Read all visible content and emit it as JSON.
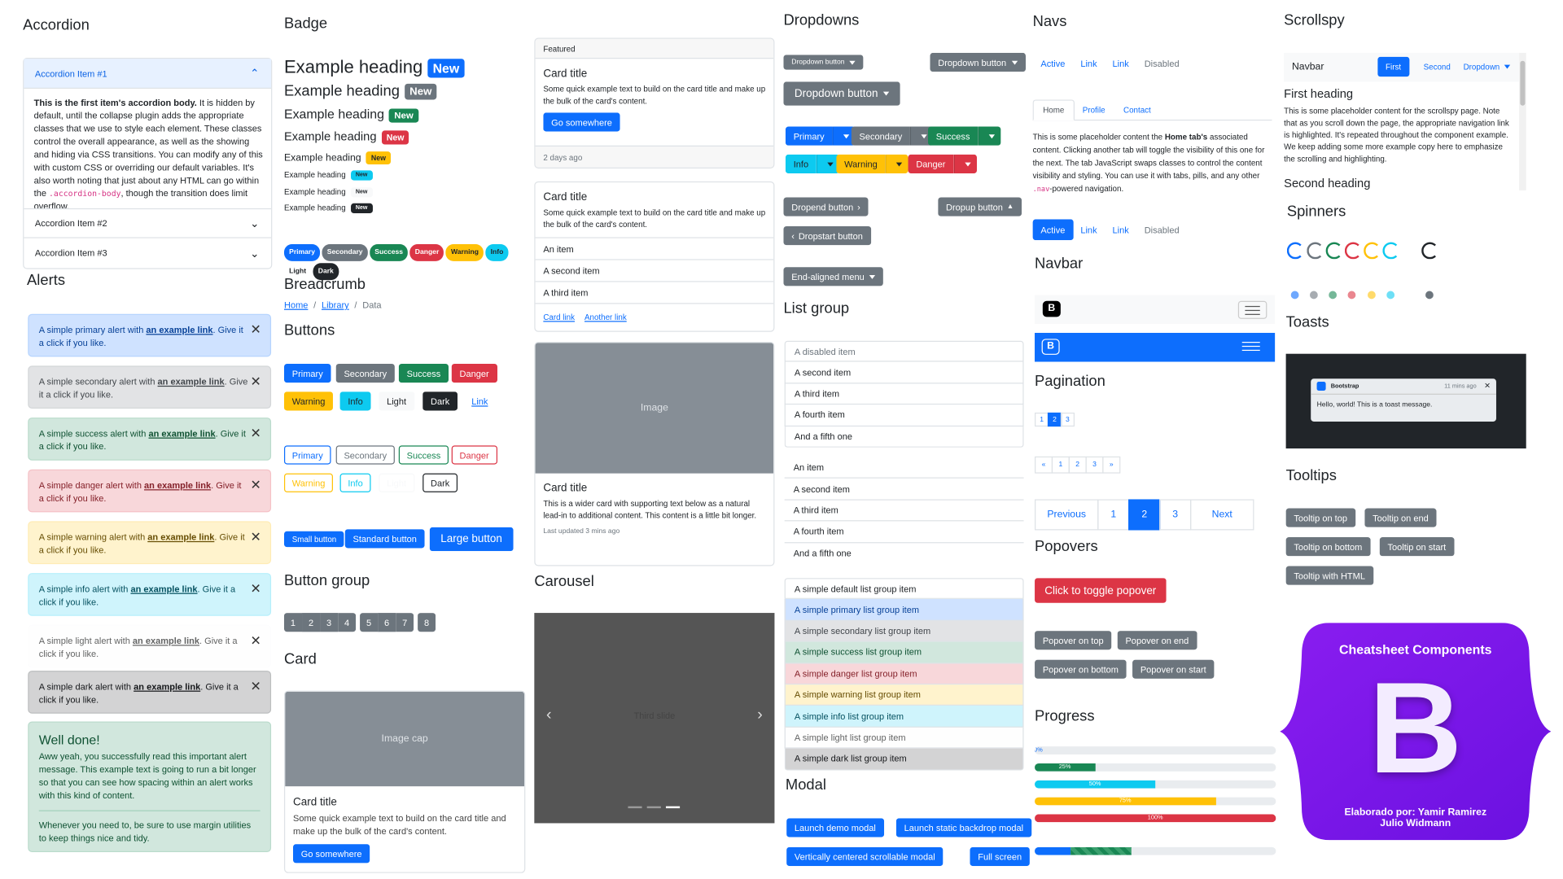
{
  "accordion": {
    "title": "Accordion",
    "item1": "Accordion Item #1",
    "body_strong": "This is the first item's accordion body.",
    "body": " It is hidden by default, until the collapse plugin adds the appropriate classes that we use to style each element. These classes control the overall appearance, as well as the showing and hiding via CSS transitions. You can modify any of this with custom CSS or overriding our default variables. It's also worth noting that just about any HTML can go within the ",
    "code": ".accordion-body",
    "body_end": ", though the transition does limit overflow.",
    "item2": "Accordion Item #2",
    "item3": "Accordion Item #3"
  },
  "alerts": {
    "title": "Alerts",
    "pre": "A simple ",
    "mid": " alert with ",
    "link": "an example link",
    "post": ". Give it a click if you like.",
    "kinds": [
      "primary",
      "secondary",
      "success",
      "danger",
      "warning",
      "info",
      "light",
      "dark"
    ],
    "heading": "Well done!",
    "p1": "Aww yeah, you successfully read this important alert message. This example text is going to run a bit longer so that you can see how spacing within an alert works with this kind of content.",
    "p2": "Whenever you need to, be sure to use margin utilities to keep things nice and tidy."
  },
  "badge": {
    "title": "Badge",
    "heading": "Example heading",
    "new": "New",
    "pills": [
      "Primary",
      "Secondary",
      "Success",
      "Danger",
      "Warning",
      "Info",
      "Light",
      "Dark"
    ]
  },
  "breadcrumb": {
    "title": "Breadcrumb",
    "items": [
      "Home",
      "Library",
      "Data"
    ]
  },
  "buttons": {
    "title": "Buttons",
    "labels": [
      "Primary",
      "Secondary",
      "Success",
      "Danger",
      "Warning",
      "Info",
      "Light",
      "Dark",
      "Link"
    ],
    "outline": [
      "Primary",
      "Secondary",
      "Success",
      "Danger",
      "Warning",
      "Info",
      "Light",
      "Dark"
    ],
    "small": "Small button",
    "standard": "Standard button",
    "large": "Large button"
  },
  "button_group": {
    "title": "Button group",
    "items": [
      "1",
      "2",
      "3",
      "4",
      "5",
      "6",
      "7",
      "8"
    ]
  },
  "card": {
    "title": "Card",
    "image_cap": "Image cap",
    "card_title": "Card title",
    "text": "Some quick example text to build on the card title and make up the bulk of the card's content.",
    "button": "Go somewhere"
  },
  "cards": {
    "featured": "Featured",
    "title": "Card title",
    "text": "Some quick example text to build on the card title and make up the bulk of the card's content.",
    "go": "Go somewhere",
    "ago": "2 days ago",
    "items": [
      "An item",
      "A second item",
      "A third item"
    ],
    "link1": "Card link",
    "link2": "Another link",
    "image": "Image",
    "wide_text": "This is a wider card with supporting text below as a natural lead-in to additional content. This content is a little bit longer.",
    "updated": "Last updated 3 mins ago"
  },
  "carousel": {
    "title": "Carousel",
    "slide": "Third slide"
  },
  "dropdowns": {
    "title": "Dropdowns",
    "btn": "Dropdown button",
    "split": [
      "Primary",
      "Secondary",
      "Success",
      "Info",
      "Warning",
      "Danger"
    ],
    "dropend": "Dropend button",
    "dropup": "Dropup button",
    "dropstart": "Dropstart button",
    "end_aligned": "End-aligned menu"
  },
  "list_group": {
    "title": "List group",
    "list1": [
      "A disabled item",
      "A second item",
      "A third item",
      "A fourth item",
      "And a fifth one"
    ],
    "list2": [
      "An item",
      "A second item",
      "A third item",
      "A fourth item",
      "And a fifth one"
    ],
    "list3": [
      "A simple default list group item",
      "A simple primary list group item",
      "A simple secondary list group item",
      "A simple success list group item",
      "A simple danger list group item",
      "A simple warning list group item",
      "A simple info list group item",
      "A simple light list group item",
      "A simple dark list group item"
    ]
  },
  "modal": {
    "title": "Modal",
    "b1": "Launch demo modal",
    "b2": "Launch static backdrop modal",
    "b3": "Vertically centered scrollable modal",
    "b4": "Full screen"
  },
  "navs": {
    "title": "Navs",
    "links": [
      "Active",
      "Link",
      "Link",
      "Disabled"
    ],
    "tabs": [
      "Home",
      "Profile",
      "Contact"
    ],
    "tab_pre": "This is some placeholder content the ",
    "tab_strong": "Home tab's",
    "tab_mid": " associated content. Clicking another tab will toggle the visibility of this one for the next. The tab JavaScript swaps classes to control the content visibility and styling. You can use it with tabs, pills, and any other ",
    "tab_code": ".nav",
    "tab_end": "-powered navigation.",
    "pills": [
      "Active",
      "Link",
      "Link",
      "Disabled"
    ]
  },
  "navbar": {
    "title": "Navbar"
  },
  "pagination": {
    "title": "Pagination",
    "small": [
      "1",
      "2",
      "3"
    ],
    "arrows": [
      "«",
      "1",
      "2",
      "3",
      "»"
    ],
    "large": [
      "Previous",
      "1",
      "2",
      "3",
      "Next"
    ]
  },
  "popovers": {
    "title": "Popovers",
    "toggle": "Click to toggle popover",
    "top": "Popover on top",
    "end": "Popover on end",
    "bottom": "Popover on bottom",
    "start": "Popover on start"
  },
  "progress": {
    "title": "Progress",
    "bars": [
      {
        "label": "0%",
        "value": 0
      },
      {
        "label": "25%",
        "value": 25
      },
      {
        "label": "50%",
        "value": 50
      },
      {
        "label": "75%",
        "value": 75
      },
      {
        "label": "100%",
        "value": 100
      }
    ],
    "striped": {
      "value": 15,
      "striped_value": 40
    }
  },
  "scrollspy": {
    "title": "Scrollspy",
    "brand": "Navbar",
    "links": [
      "First",
      "Second",
      "Dropdown"
    ],
    "h1": "First heading",
    "p1": "This is some placeholder content for the scrollspy page. Note that as you scroll down the page, the appropriate navigation link is highlighted. It's repeated throughout the component example. We keep adding some more example copy here to emphasize the scrolling and highlighting.",
    "h2": "Second heading"
  },
  "spinners": {
    "title": "Spinners"
  },
  "toasts": {
    "title": "Toasts",
    "brand": "Bootstrap",
    "time": "11 mins ago",
    "body": "Hello, world! This is a toast message."
  },
  "tooltips": {
    "title": "Tooltips",
    "top": "Tooltip on top",
    "end": "Tooltip on end",
    "bottom": "Tooltip on bottom",
    "start": "Tooltip on start",
    "html": "Tooltip with HTML"
  },
  "logo": {
    "title": "Cheatsheet Components",
    "letter": "B",
    "credit1": "Elaborado por: Yamir Ramirez",
    "credit2": "Julio Widmann",
    "color": "#7a1af5"
  }
}
